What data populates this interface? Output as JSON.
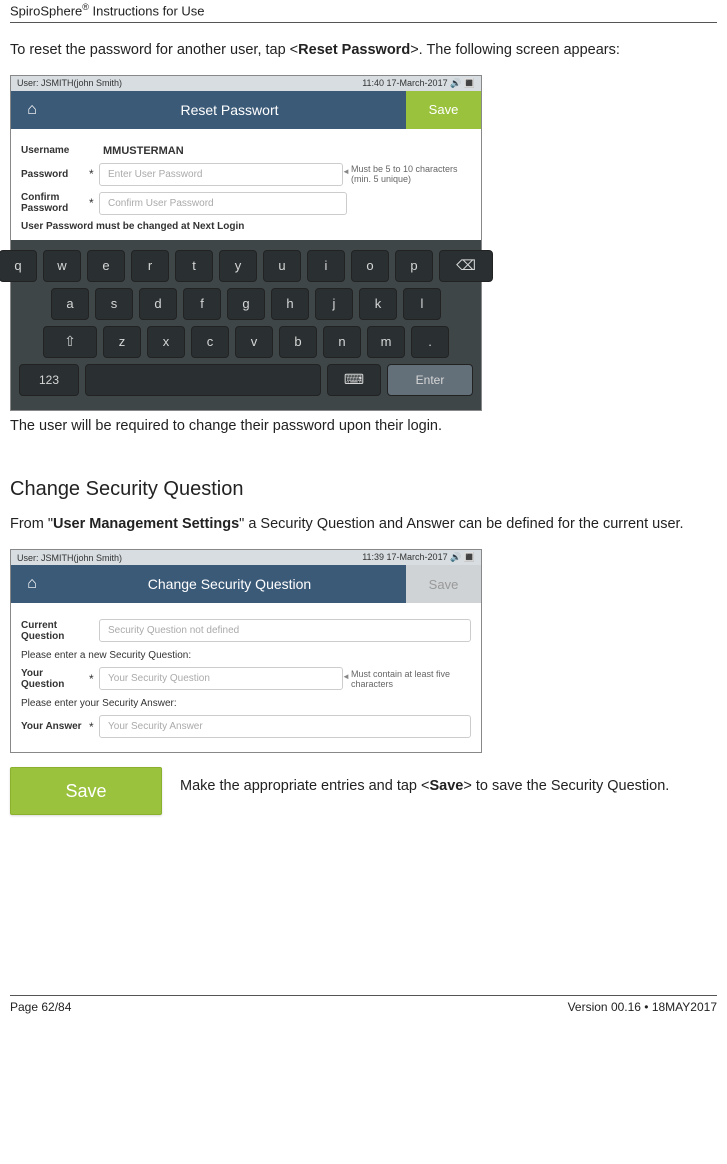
{
  "header": {
    "product": "SpiroSphere",
    "reg": "®",
    "suffix": " Instructions for Use"
  },
  "para1_a": "To reset the password for another user, tap <",
  "para1_bold": "Reset Password",
  "para1_b": ">. The following screen appears:",
  "shot1": {
    "status_left": "User: JSMITH(john Smith)",
    "status_right": "11:40 17-March-2017  🔊 🔳",
    "title": "Reset Passwort",
    "save": "Save",
    "username_label": "Username",
    "username_value": "MMUSTERMAN",
    "password_label": "Password",
    "password_ph": "Enter User Password",
    "hint": "Must be 5 to 10 characters (min. 5 unique)",
    "confirm_label": "Confirm Password",
    "confirm_ph": "Confirm User Password",
    "note": "User Password must be changed at Next Login",
    "row1": [
      "q",
      "w",
      "e",
      "r",
      "t",
      "y",
      "u",
      "i",
      "o",
      "p"
    ],
    "back": "⌫",
    "row2": [
      "a",
      "s",
      "d",
      "f",
      "g",
      "h",
      "j",
      "k",
      "l"
    ],
    "row3": [
      "z",
      "x",
      "c",
      "v",
      "b",
      "n",
      "m",
      "."
    ],
    "shift": "⇧",
    "num": "123",
    "kbicon": "⌨",
    "enter": "Enter"
  },
  "para2": "The user will be required to change their password upon their login.",
  "heading": "Change Security Question",
  "para3_a": "From \"",
  "para3_bold": "User Management Settings",
  "para3_b": "\" a Security Question and Answer can be defined for the current user.",
  "shot2": {
    "status_left": "User: JSMITH(john Smith)",
    "status_right": "11:39 17-March-2017  🔊 🔳",
    "title": "Change Security Question",
    "save": "Save",
    "curq_label": "Current Question",
    "curq_ph": "Security Question not defined",
    "sec1": "Please enter a new Security Question:",
    "yourq_label": "Your Question",
    "yourq_ph": "Your Security Question",
    "hint": "Must contain at least five characters",
    "sec2": "Please enter your Security Answer:",
    "youra_label": "Your Answer",
    "youra_ph": "Your Security Answer"
  },
  "savebtn": "Save",
  "para4_a": "Make the appropriate entries and tap <",
  "para4_bold": "Save",
  "para4_b": "> to save the Security Question.",
  "footer": {
    "left": "Page 62/84",
    "right": "Version 00.16 • 18MAY2017"
  }
}
